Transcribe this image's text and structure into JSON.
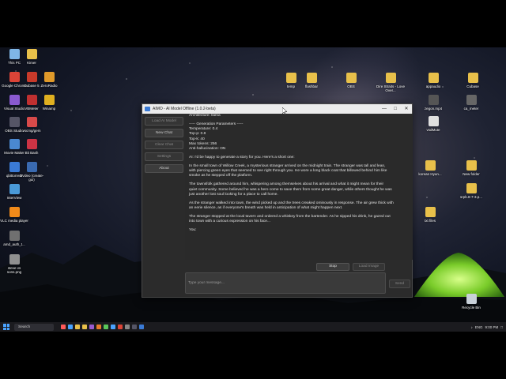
{
  "desktop": {
    "icons_left": [
      {
        "label": "This PC",
        "color": "#7fb6e6"
      },
      {
        "label": "Kimer",
        "color": "#e8c04a"
      },
      {
        "label": "Google Chrome",
        "color": "#db4437"
      },
      {
        "label": "Cubase 5",
        "color": "#c83a2a"
      },
      {
        "label": "ZeroRadio",
        "color": "#e09a2a"
      },
      {
        "label": "Visual Studio",
        "color": "#8a5ad0"
      },
      {
        "label": "VBMeter",
        "color": "#c03030"
      },
      {
        "label": "Winamp",
        "color": "#e0b020"
      },
      {
        "label": "OBS Studio",
        "color": "#555566"
      },
      {
        "label": "vscmg/gem",
        "color": "#d84a4a"
      },
      {
        "label": "Movie Maker",
        "color": "#4a88d0"
      },
      {
        "label": "Bit Bash",
        "color": "#cc3344"
      },
      {
        "label": "qbittorrent",
        "color": "#3a7ad5"
      },
      {
        "label": "DVdeo (create-gui)",
        "color": "#3a6ab0"
      },
      {
        "label": "InterView",
        "color": "#4a9ad8"
      },
      {
        "label": "VLC media player",
        "color": "#f08a1a"
      },
      {
        "label": "amd_auth_t...",
        "color": "#707070"
      },
      {
        "label": "steve vs sons.png",
        "color": "#909090"
      }
    ],
    "icons_right": [
      {
        "label": "temp",
        "color": "#e8c04a"
      },
      {
        "label": "flashbar",
        "color": "#e8c04a"
      },
      {
        "label": "OBS",
        "color": "#e8c04a"
      },
      {
        "label": "Dire Straits - Love Over...",
        "color": "#e8c04a"
      },
      {
        "label": "appaudio",
        "color": "#e8c04a"
      },
      {
        "label": "Cubase",
        "color": "#e8c04a"
      },
      {
        "label": "zegon.mp4",
        "color": "#555555"
      },
      {
        "label": "ca_meter",
        "color": "#666666"
      },
      {
        "label": "vsdMute",
        "color": "#e0e0e0"
      },
      {
        "label": "korean Hyun...",
        "color": "#e8c04a"
      },
      {
        "label": "New folder",
        "color": "#e8c04a"
      },
      {
        "label": "srpb.8-7-3.p...",
        "color": "#e8c04a"
      },
      {
        "label": "txt files",
        "color": "#e8c04a"
      },
      {
        "label": "Recycle Bin",
        "color": "#c8d0d8"
      }
    ]
  },
  "app": {
    "title": "AIMO - AI Model Offline (1.0.2-beta)",
    "sidebar": {
      "load_model": "Load AI Model",
      "new_chat": "New Chat",
      "clear_chat": "Clear Chat",
      "settings": "Settings",
      "about": "About"
    },
    "chat": {
      "lines": [
        "Architecture: llama",
        "",
        "----- Generation Parameters -----",
        "Temperature: 0.4",
        "Top-p: 0.8",
        "Top-k: 40",
        "Max tokens: 256",
        "Anti-hallucination: ON",
        "",
        "AI: I'd be happy to generate a story for you. Here's a short one:",
        "",
        "In the small town of Willow Creek, a mysterious stranger arrived on the midnight train. The stranger was tall and lean,",
        "with piercing green eyes that seemed to see right through you. He wore a long black coat that billowed behind him like",
        "smoke as he stepped off the platform.",
        "",
        "The townsfolk gathered around him, whispering among themselves about his arrival and what it might mean for their",
        "quiet community. Some believed he was a hero come to save them from some great danger, while others thought he was",
        "just another lost soul looking for a place to call home.",
        "",
        "As the stranger walked into town, the wind picked up and the trees creaked ominously in response. The air grew thick with",
        "an eerie silence, as if everyone's breath was held in anticipation of what might happen next.",
        "",
        "The stranger stopped at the local tavern and ordered a whiskey from the bartender. As he sipped his drink, he gazed out",
        "into town with a curious expression on his face...",
        "",
        "You:"
      ]
    },
    "stop_button": "Stop",
    "load_image_button": "Load Image",
    "input_placeholder": "Type your message...",
    "send_button": "Send"
  },
  "taskbar": {
    "search_placeholder": "Search",
    "language": "ENG",
    "time": "9:00 PM",
    "app_colors": [
      "#ff5a5a",
      "#4aa3ff",
      "#e8c04a",
      "#e8c04a",
      "#9a5ad0",
      "#e87a2a",
      "#5ac85a",
      "#4aa3ff",
      "#db4437",
      "#888888",
      "#555566",
      "#3a7ad5"
    ]
  }
}
